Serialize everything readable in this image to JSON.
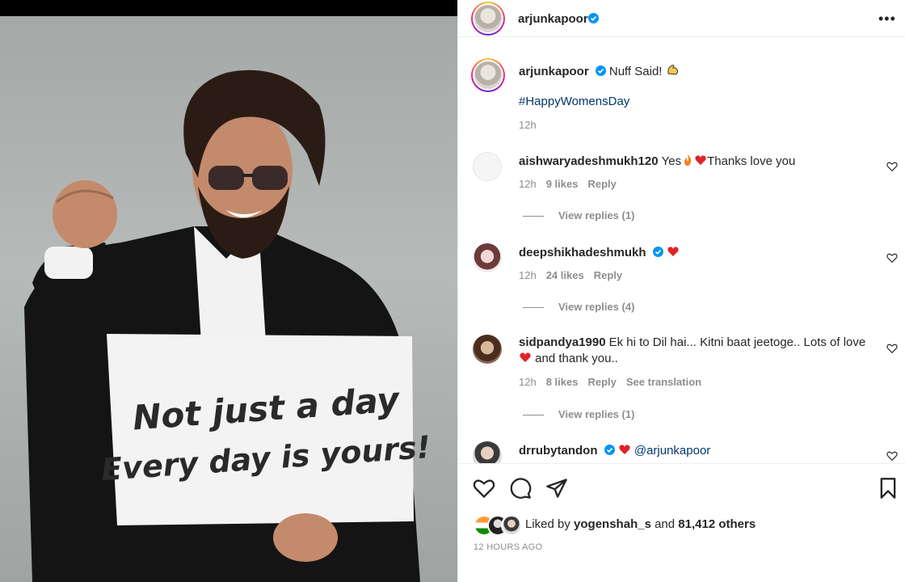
{
  "header": {
    "username": "arjunkapoor",
    "more_label": "•••"
  },
  "photo": {
    "sign_line1": "Not just a day",
    "sign_line2": "Every day is yours!"
  },
  "caption": {
    "username": "arjunkapoor",
    "text": "Nuff Said! ",
    "hashtag": "#HappyWomensDay",
    "time": "12h"
  },
  "comments": [
    {
      "username": "aishwaryadeshmukh120",
      "text_before": "Yes",
      "text_after": "Thanks love you",
      "time": "12h",
      "likes": "9 likes",
      "reply": "Reply",
      "view_replies": "View replies (1)"
    },
    {
      "username": "deepshikhadeshmukh",
      "time": "12h",
      "likes": "24 likes",
      "reply": "Reply",
      "view_replies": "View replies (4)"
    },
    {
      "username": "sidpandya1990",
      "text": "Ek hi to Dil hai... Kitni baat jeetoge.. Lots of love",
      "text_line2": "and thank you..",
      "time": "12h",
      "likes": "8 likes",
      "reply": "Reply",
      "translation": "See translation",
      "view_replies": "View replies (1)"
    },
    {
      "username": "drrubytandon",
      "mention": "@arjunkapoor"
    }
  ],
  "likes": {
    "prefix": "Liked by",
    "user": "yogenshah_s",
    "joiner": "and",
    "count": "81,412 others"
  },
  "posted": "12 HOURS AGO",
  "colors": {
    "link": "#00376b",
    "muted": "#8e8e8e",
    "verified": "#0095f6",
    "heart": "#ed4956"
  },
  "icons": [
    "more-icon",
    "verified-icon",
    "heart-icon",
    "comment-icon",
    "share-icon",
    "save-icon",
    "flexed-bicep-emoji",
    "fire-emoji",
    "red-heart-emoji"
  ]
}
